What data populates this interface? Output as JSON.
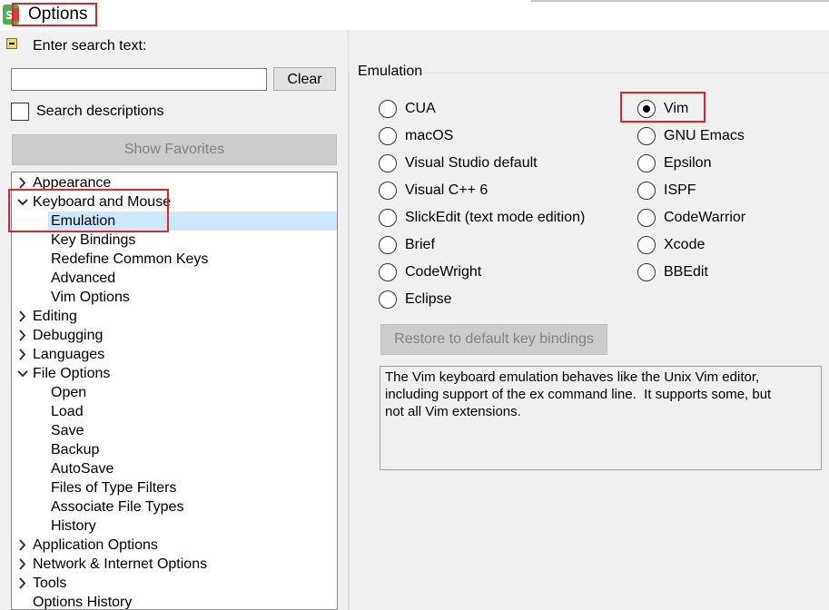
{
  "window": {
    "title": "Options",
    "icon": "slickedit-app-icon"
  },
  "search": {
    "label": "Enter search text:",
    "value": "",
    "placeholder": "",
    "clear_label": "Clear",
    "descriptions_label": "Search descriptions",
    "descriptions_checked": false,
    "favorites_label": "Show Favorites"
  },
  "tree": {
    "items": [
      {
        "label": "Appearance",
        "level": 0,
        "expander": "collapsed"
      },
      {
        "label": "Keyboard and Mouse",
        "level": 0,
        "expander": "expanded"
      },
      {
        "label": "Emulation",
        "level": 1,
        "expander": "none",
        "selected": true
      },
      {
        "label": "Key Bindings",
        "level": 1,
        "expander": "none"
      },
      {
        "label": "Redefine Common Keys",
        "level": 1,
        "expander": "none"
      },
      {
        "label": "Advanced",
        "level": 1,
        "expander": "none"
      },
      {
        "label": "Vim Options",
        "level": 1,
        "expander": "none"
      },
      {
        "label": "Editing",
        "level": 0,
        "expander": "collapsed"
      },
      {
        "label": "Debugging",
        "level": 0,
        "expander": "collapsed"
      },
      {
        "label": "Languages",
        "level": 0,
        "expander": "collapsed"
      },
      {
        "label": "File Options",
        "level": 0,
        "expander": "expanded"
      },
      {
        "label": "Open",
        "level": 1,
        "expander": "none"
      },
      {
        "label": "Load",
        "level": 1,
        "expander": "none"
      },
      {
        "label": "Save",
        "level": 1,
        "expander": "none"
      },
      {
        "label": "Backup",
        "level": 1,
        "expander": "none"
      },
      {
        "label": "AutoSave",
        "level": 1,
        "expander": "none"
      },
      {
        "label": "Files of Type Filters",
        "level": 1,
        "expander": "none"
      },
      {
        "label": "Associate File Types",
        "level": 1,
        "expander": "none"
      },
      {
        "label": "History",
        "level": 1,
        "expander": "none"
      },
      {
        "label": "Application Options",
        "level": 0,
        "expander": "collapsed"
      },
      {
        "label": "Network & Internet Options",
        "level": 0,
        "expander": "collapsed"
      },
      {
        "label": "Tools",
        "level": 0,
        "expander": "collapsed"
      },
      {
        "label": "Options History",
        "level": 0,
        "expander": "none"
      }
    ]
  },
  "emulation": {
    "group_label": "Emulation",
    "left_options": [
      "CUA",
      "macOS",
      "Visual Studio default",
      "Visual C++ 6",
      "SlickEdit (text mode edition)",
      "Brief",
      "CodeWright",
      "Eclipse"
    ],
    "right_options": [
      "Vim",
      "GNU Emacs",
      "Epsilon",
      "ISPF",
      "CodeWarrior",
      "Xcode",
      "BBEdit"
    ],
    "selected": "Vim",
    "restore_label": "Restore to default key bindings",
    "description": "The Vim keyboard emulation behaves like the Unix Vim editor,\nincluding support of the ex command line.  It supports some, but\nnot all Vim extensions."
  },
  "colors": {
    "highlight_red": "#e0242a",
    "selection_blue": "#cce8ff",
    "panel_bg": "#f0f0f0"
  }
}
